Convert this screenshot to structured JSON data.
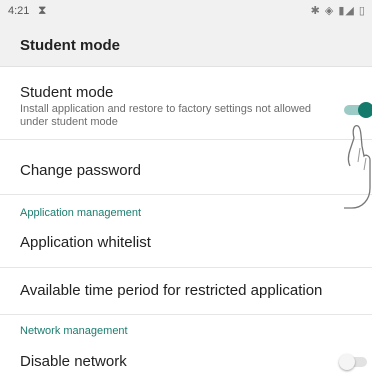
{
  "status_bar": {
    "time": "4:21",
    "hourglass_icon": "⧗",
    "right_icons": "✱ ◈ ▮◢ ▯"
  },
  "app_bar": {
    "title": "Student mode"
  },
  "settings": {
    "student_mode": {
      "title": "Student mode",
      "summary": "Install application and restore to factory settings not allowed under student mode",
      "enabled": true
    },
    "change_password": {
      "title": "Change password"
    },
    "application_section": "Application management",
    "application_whitelist": {
      "title": "Application whitelist"
    },
    "available_time": {
      "title": "Available time period for restricted application"
    },
    "network_section": "Network management",
    "disable_network": {
      "title": "Disable network",
      "enabled": false
    }
  },
  "colors": {
    "accent": "#137a6c",
    "section_text": "#1b7d6f",
    "switch_on_track": "#9ccbc5",
    "appbar_bg": "#f1f1f1"
  }
}
